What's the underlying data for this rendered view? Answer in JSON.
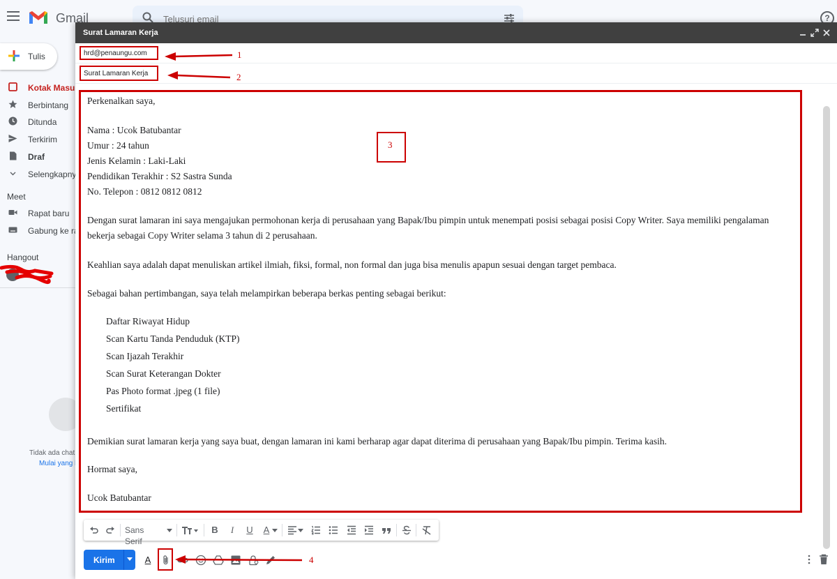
{
  "app": {
    "name": "Gmail",
    "help": "?"
  },
  "search": {
    "placeholder": "Telusuri email"
  },
  "sidebar": {
    "compose_label": "Tulis",
    "items": [
      {
        "label": "Kotak Masuk"
      },
      {
        "label": "Berbintang"
      },
      {
        "label": "Ditunda"
      },
      {
        "label": "Terkirim"
      },
      {
        "label": "Draf"
      },
      {
        "label": "Selengkapnya"
      }
    ],
    "meet_heading": "Meet",
    "meet_items": [
      {
        "label": "Rapat baru"
      },
      {
        "label": "Gabung ke rapat"
      }
    ],
    "hangout_heading": "Hangout",
    "no_chat": "Tidak ada chat",
    "start_chat": "Mulai yang baru"
  },
  "compose": {
    "title": "Surat Lamaran Kerja",
    "to": "hrd@penaungu.com",
    "subject": "Surat Lamaran Kerja",
    "body": [
      "Perkenalkan saya,",
      "Nama : Ucok Batubantar",
      "Umur : 24 tahun",
      "Jenis Kelamin : Laki-Laki",
      "Pendidikan Terakhir : S2 Sastra Sunda",
      "No. Telepon : 0812 0812 0812",
      "Dengan surat lamaran ini saya mengajukan permohonan kerja di perusahaan yang Bapak/Ibu pimpin untuk menempati posisi sebagai posisi Copy Writer. Saya memiliki pengalaman bekerja sebagai Copy Writer selama 3 tahun di 2 perusahaan.",
      "Keahlian saya adalah dapat menuliskan artikel ilmiah, fiksi, formal, non formal dan juga bisa menulis apapun sesuai dengan target pembaca.",
      "Sebagai bahan pertimbangan, saya telah melampirkan beberapa berkas penting sebagai berikut:",
      "Daftar Riwayat Hidup",
      "Scan Kartu Tanda Penduduk (KTP)",
      "Scan Ijazah Terakhir",
      "Scan Surat Keterangan Dokter",
      "Pas Photo format .jpeg (1 file)",
      "Sertifikat",
      "Demikian surat lamaran kerja yang saya buat, dengan lamaran ini kami berharap agar dapat diterima di perusahaan yang Bapak/Ibu pimpin. Terima kasih.",
      "Hormat saya,",
      "Ucok Batubantar"
    ],
    "toolbar": {
      "font": "Sans Serif",
      "bold": "B",
      "italic": "I",
      "underline": "U",
      "text_color": "A"
    },
    "send_label": "Kirim",
    "format_label": "A"
  },
  "annotations": {
    "n1": "1",
    "n2": "2",
    "n3": "3",
    "n4": "4"
  },
  "colors": {
    "annotation": "#cc0000",
    "send": "#1a73e8",
    "titlebar": "#404040",
    "inbox": "#c5221f"
  }
}
